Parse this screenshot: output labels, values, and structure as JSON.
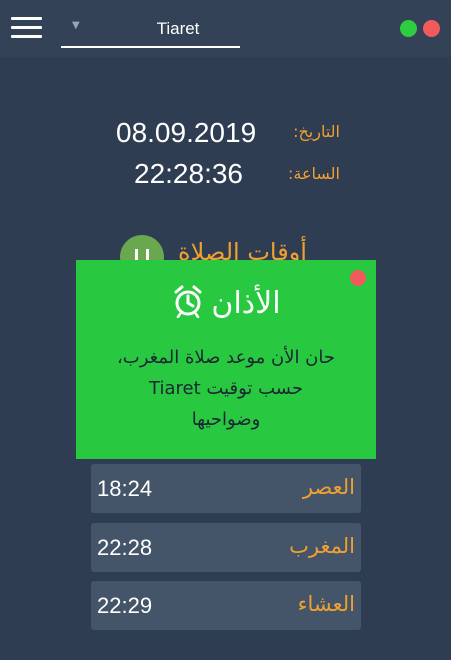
{
  "header": {
    "city": "Tiaret",
    "controls": {
      "green": "#2ecc40",
      "red": "#f05a5a"
    }
  },
  "info": {
    "date_label": "التاريخ:",
    "date_value": "08.09.2019",
    "time_label": "الساعة:",
    "time_value": "22:28:36"
  },
  "section": {
    "title": "أوقات الصلاة"
  },
  "popup": {
    "title": "الأذان",
    "icon": "alarm-clock-icon",
    "line1": "حان الأن موعد صلاة المغرب،",
    "line2": "حسب توقيت Tiaret",
    "line3": "وضواحيها"
  },
  "prayers": [
    {
      "name": "العصر",
      "time": "18:24"
    },
    {
      "name": "المغرب",
      "time": "22:28"
    },
    {
      "name": "العشاء",
      "time": "22:29"
    }
  ],
  "colors": {
    "background": "#2f3d52",
    "accent": "#f0a030",
    "popup": "#28c940",
    "row": "#455569"
  }
}
